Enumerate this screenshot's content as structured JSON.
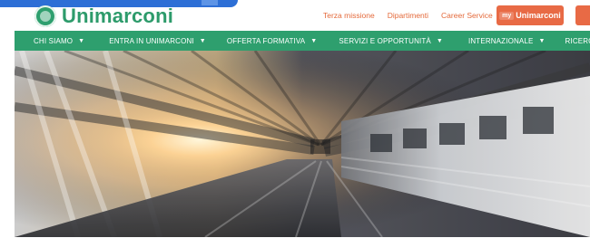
{
  "header": {
    "brand": "Unimarconi",
    "links": [
      "Terza missione",
      "Dipartimenti",
      "Career Service"
    ],
    "my_button": {
      "badge": "my",
      "label": "Unimarconi"
    }
  },
  "nav": {
    "items": [
      "CHI SIAMO",
      "ENTRA IN UNIMARCONI",
      "OFFERTA FORMATIVA",
      "SERVIZI E OPPORTUNITÀ",
      "INTERNAZIONALE",
      "RICERCA"
    ]
  },
  "hero": {
    "image_semantic": "train-tunnel-photo"
  },
  "colors": {
    "brand_green": "#2e9f6e",
    "accent_orange": "#e86a45",
    "link_orange": "#e46a3b"
  }
}
